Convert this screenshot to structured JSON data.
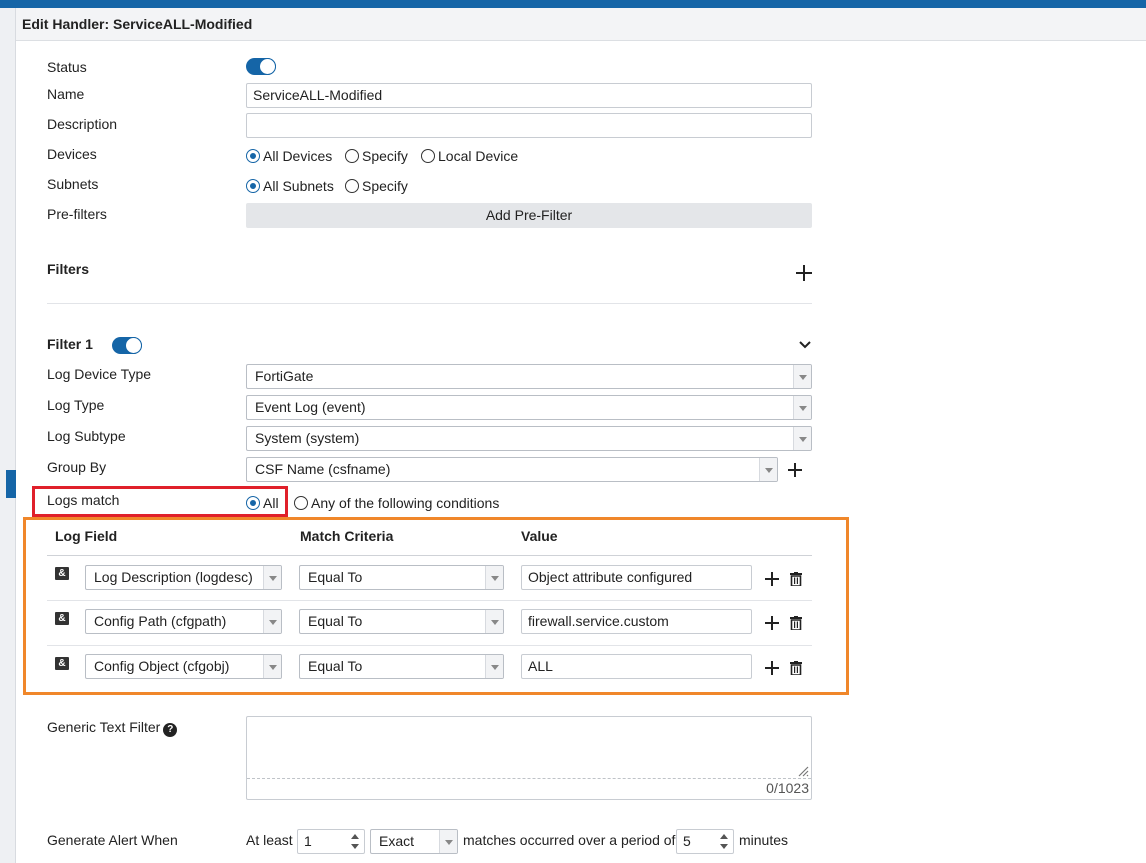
{
  "header": {
    "title": "Edit Handler: ServiceALL-Modified"
  },
  "form": {
    "status_label": "Status",
    "name_label": "Name",
    "name_value": "ServiceALL-Modified",
    "description_label": "Description",
    "description_value": "",
    "devices_label": "Devices",
    "devices_options": [
      "All Devices",
      "Specify",
      "Local Device"
    ],
    "subnets_label": "Subnets",
    "subnets_options": [
      "All Subnets",
      "Specify"
    ],
    "prefilters_label": "Pre-filters",
    "add_prefilter_label": "Add Pre-Filter",
    "filters_label": "Filters"
  },
  "filter1": {
    "title": "Filter 1",
    "log_device_type_label": "Log Device Type",
    "log_device_type_value": "FortiGate",
    "log_type_label": "Log Type",
    "log_type_value": "Event Log (event)",
    "log_subtype_label": "Log Subtype",
    "log_subtype_value": "System (system)",
    "group_by_label": "Group By",
    "group_by_value": "CSF Name (csfname)",
    "logs_match_label": "Logs match",
    "logs_match_options": [
      "All",
      "Any of the following conditions"
    ]
  },
  "conditions": {
    "headers": [
      "Log Field",
      "Match Criteria",
      "Value"
    ],
    "rows": [
      {
        "field": "Log Description (logdesc)",
        "criteria": "Equal To",
        "value": "Object attribute configured"
      },
      {
        "field": "Config Path (cfgpath)",
        "criteria": "Equal To",
        "value": "firewall.service.custom"
      },
      {
        "field": "Config Object (cfgobj)",
        "criteria": "Equal To",
        "value": "ALL"
      }
    ],
    "and_symbol": "&"
  },
  "generic_text": {
    "label": "Generic Text Filter",
    "help": "?",
    "counter": "0/1023"
  },
  "alert": {
    "label": "Generate Alert When",
    "at_least": "At least",
    "count_value": "1",
    "mode_value": "Exact",
    "matches_text": "matches occurred over a period of",
    "period_value": "5",
    "unit": "minutes"
  },
  "colors": {
    "accent": "#1565a7",
    "highlight_red": "#e0202a",
    "highlight_orange": "#f0872a"
  }
}
